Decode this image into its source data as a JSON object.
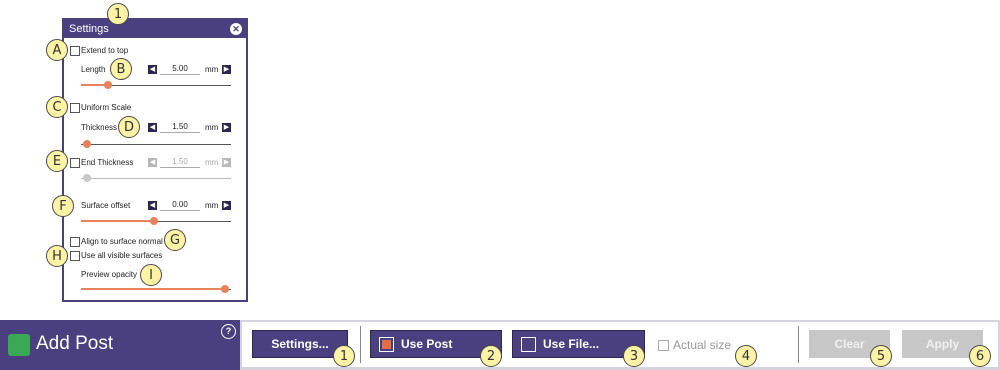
{
  "panel": {
    "title": "Settings",
    "extend_to_top": "Extend to top",
    "length_label": "Length",
    "length_value": "5.00",
    "uniform_scale": "Uniform Scale",
    "thickness_label": "Thickness",
    "thickness_value": "1.50",
    "end_thickness_label": "End Thickness",
    "end_thickness_value": "1.50",
    "surface_offset_label": "Surface offset",
    "surface_offset_value": "0.00",
    "unit": "mm",
    "align_label": "Align to surface normal",
    "use_all_label": "Use all visible surfaces",
    "preview_opacity_label": "Preview opacity",
    "sliders": {
      "length": 0.18,
      "thickness": 0.03,
      "end_thickness": 0.03,
      "surface_offset": 0.5,
      "preview_opacity": 1.0
    }
  },
  "bar": {
    "title": "Add Post",
    "help": "?",
    "settings_button": "Settings...",
    "use_post_button": "Use Post",
    "use_file_button": "Use File...",
    "actual_size": "Actual size",
    "clear_button": "Clear",
    "apply_button": "Apply"
  },
  "callouts": {
    "panel_top": "1",
    "a": "A",
    "b": "B",
    "c": "C",
    "d": "D",
    "e": "E",
    "f": "F",
    "g": "G",
    "h": "H",
    "i": "I",
    "n1": "1",
    "n2": "2",
    "n3": "3",
    "n4": "4",
    "n5": "5",
    "n6": "6"
  },
  "colors": {
    "accent": "#4a4080",
    "slider": "#e8825a",
    "post_icon": "#3aa855",
    "callout": "#fdf3a6"
  }
}
